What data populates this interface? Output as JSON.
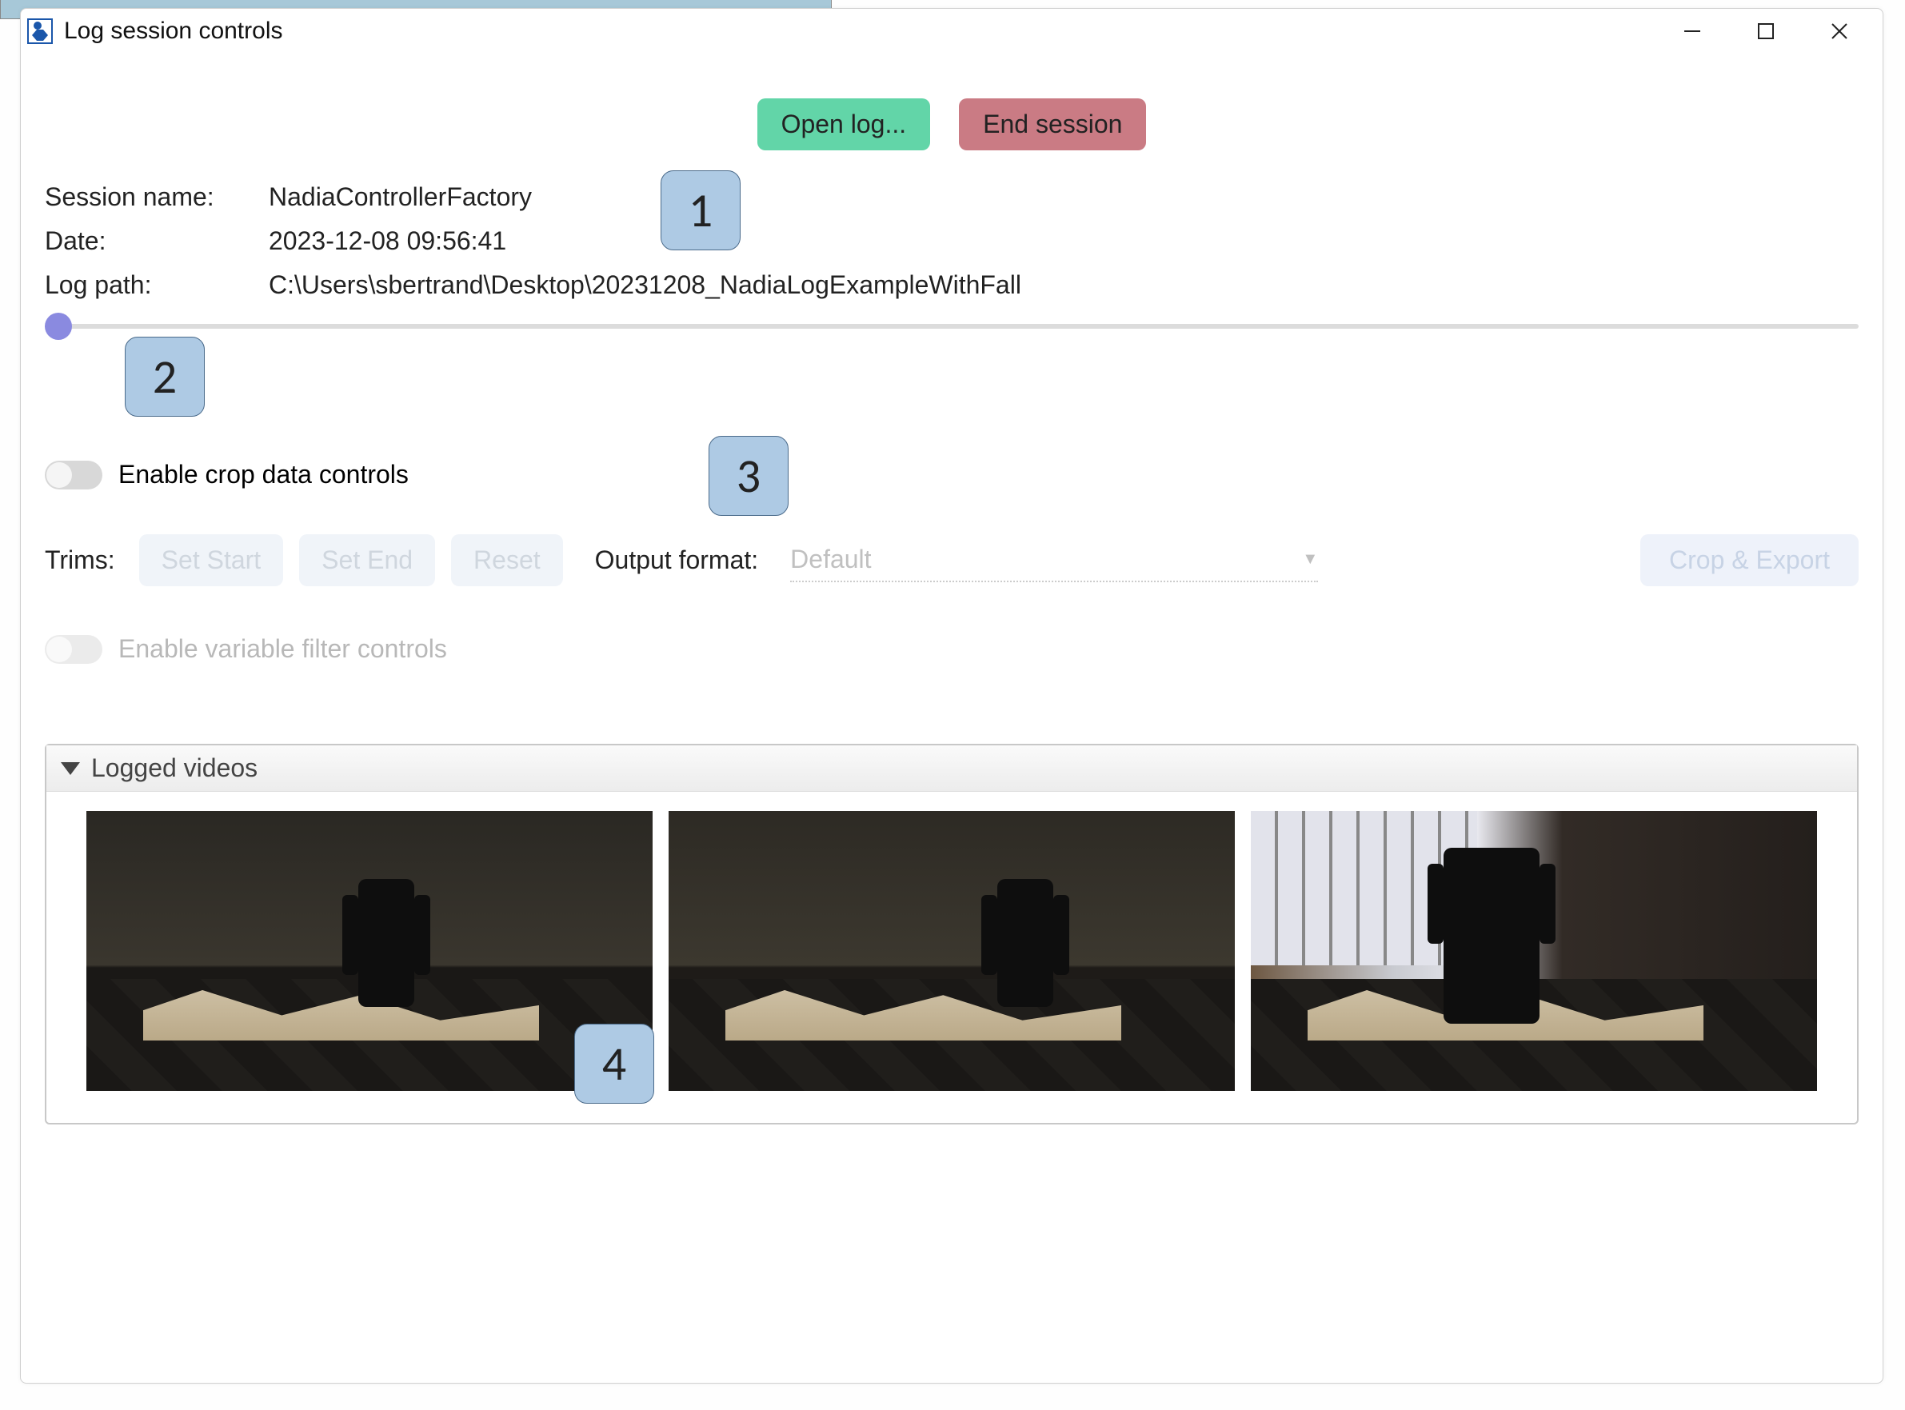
{
  "window": {
    "title": "Log session controls"
  },
  "buttons": {
    "open_log": "Open log...",
    "end_session": "End session"
  },
  "session": {
    "name_label": "Session name:",
    "name_value": "NadiaControllerFactory",
    "date_label": "Date:",
    "date_value": "2023-12-08 09:56:41",
    "path_label": "Log path:",
    "path_value": "C:\\Users\\sbertrand\\Desktop\\20231208_NadiaLogExampleWithFall"
  },
  "crop": {
    "enable_crop_label": "Enable crop data controls",
    "trims_label": "Trims:",
    "set_start": "Set Start",
    "set_end": "Set End",
    "reset": "Reset",
    "output_format_label": "Output format:",
    "output_format_value": "Default",
    "crop_export": "Crop & Export",
    "enable_filter_label": "Enable variable filter controls"
  },
  "videos": {
    "header": "Logged videos"
  },
  "callouts": {
    "c1": "1",
    "c2": "2",
    "c3": "3",
    "c4": "4"
  }
}
